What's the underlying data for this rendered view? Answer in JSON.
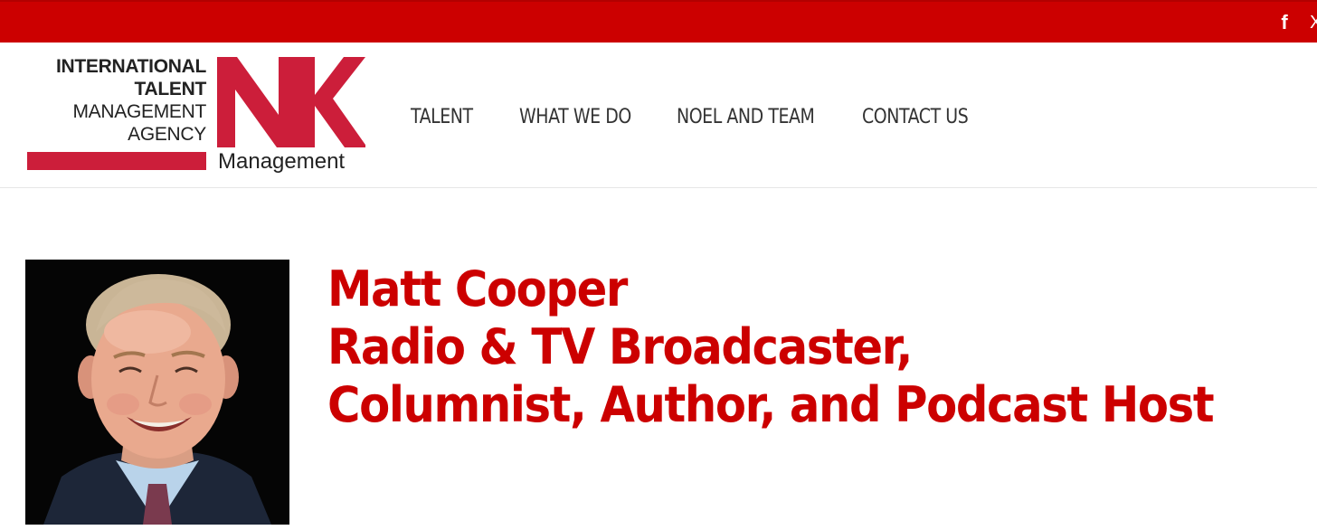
{
  "topbar": {
    "color": "#cc0000",
    "social": [
      {
        "icon": "facebook-icon",
        "glyph": "f"
      },
      {
        "icon": "x-twitter-icon",
        "glyph": "X"
      }
    ]
  },
  "logo": {
    "lines": [
      "INTERNATIONAL",
      "TALENT",
      "MANAGEMENT",
      "AGENCY"
    ],
    "brand": "NK",
    "sub": "Management",
    "accent": "#cc1e3a"
  },
  "nav": {
    "items": [
      "TALENT",
      "WHAT WE DO",
      "NOEL AND TEAM",
      "CONTACT US"
    ]
  },
  "profile": {
    "photo_alt": "Matt Cooper headshot",
    "title_lines": [
      "Matt Cooper",
      "Radio & TV Broadcaster,",
      "Columnist, Author, and Podcast Host"
    ],
    "title_color": "#cc0000"
  }
}
